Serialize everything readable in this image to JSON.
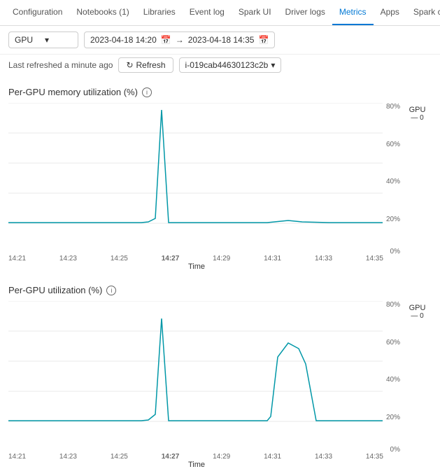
{
  "nav": {
    "tabs": [
      {
        "label": "Configuration",
        "active": false
      },
      {
        "label": "Notebooks (1)",
        "active": false
      },
      {
        "label": "Libraries",
        "active": false
      },
      {
        "label": "Event log",
        "active": false
      },
      {
        "label": "Spark UI",
        "active": false
      },
      {
        "label": "Driver logs",
        "active": false
      },
      {
        "label": "Metrics",
        "active": true
      },
      {
        "label": "Apps",
        "active": false
      },
      {
        "label": "Spark cluster U",
        "active": false
      }
    ]
  },
  "toolbar": {
    "gpu_select_label": "GPU",
    "date_start": "2023-04-18 14:20",
    "date_end": "2023-04-18 14:35",
    "arrow": "→"
  },
  "refresh_row": {
    "last_refreshed": "Last refreshed a minute ago",
    "refresh_label": "Refresh",
    "instance": "i-019cab44630123c2b"
  },
  "chart1": {
    "title": "Per-GPU memory utilization (%)",
    "legend_title": "GPU",
    "legend_item": "— 0",
    "y_labels": [
      "80%",
      "60%",
      "40%",
      "20%",
      "0%"
    ],
    "x_labels": [
      "14:21",
      "14:23",
      "14:25",
      "14:27",
      "14:29",
      "14:31",
      "14:33",
      "14:35"
    ],
    "x_axis_label": "Time"
  },
  "chart2": {
    "title": "Per-GPU utilization (%)",
    "legend_title": "GPU",
    "legend_item": "— 0",
    "y_labels": [
      "80%",
      "60%",
      "40%",
      "20%",
      "0%"
    ],
    "x_labels": [
      "14:21",
      "14:23",
      "14:25",
      "14:27",
      "14:29",
      "14:31",
      "14:33",
      "14:35"
    ],
    "x_axis_label": "Time"
  }
}
